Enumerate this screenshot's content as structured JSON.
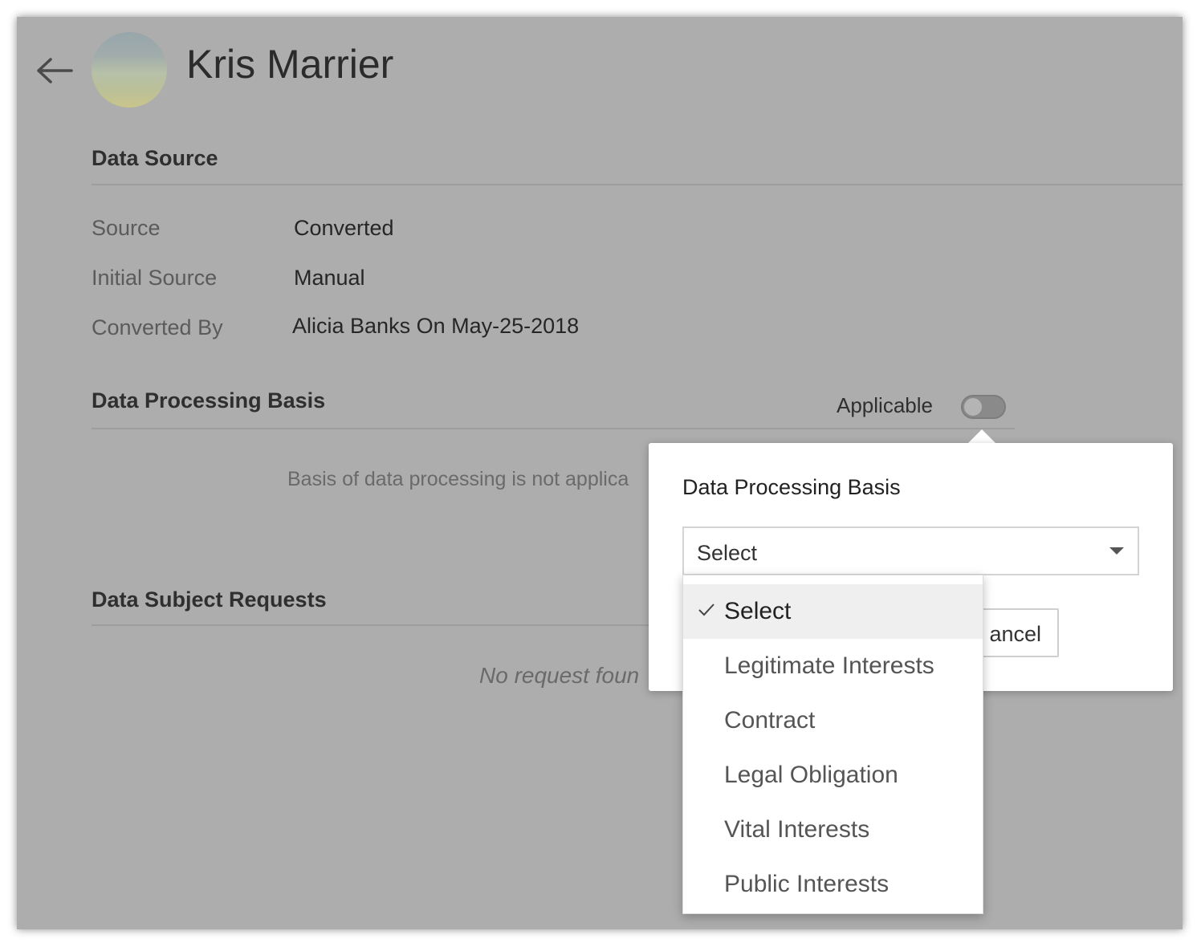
{
  "header": {
    "back_icon": "arrow-left-icon",
    "name": "Kris Marrier"
  },
  "data_source": {
    "title": "Data Source",
    "fields": [
      {
        "label": "Source",
        "value": "Converted"
      },
      {
        "label": "Initial Source",
        "value": "Manual"
      },
      {
        "label": "Converted By",
        "value": "Alicia Banks On May-25-2018"
      }
    ]
  },
  "processing_basis": {
    "title": "Data Processing Basis",
    "applicable_label": "Applicable",
    "applicable_on": false,
    "empty_text": "Basis of data processing is not applica"
  },
  "subject_requests": {
    "title": "Data Subject Requests",
    "empty_text": "No request foun"
  },
  "popover": {
    "title": "Data Processing Basis",
    "select_value": "Select",
    "cancel_label": "ancel"
  },
  "dropdown": {
    "selected_index": 0,
    "options": [
      "Select",
      "Legitimate Interests",
      "Contract",
      "Legal Obligation",
      "Vital Interests",
      "Public Interests"
    ]
  }
}
